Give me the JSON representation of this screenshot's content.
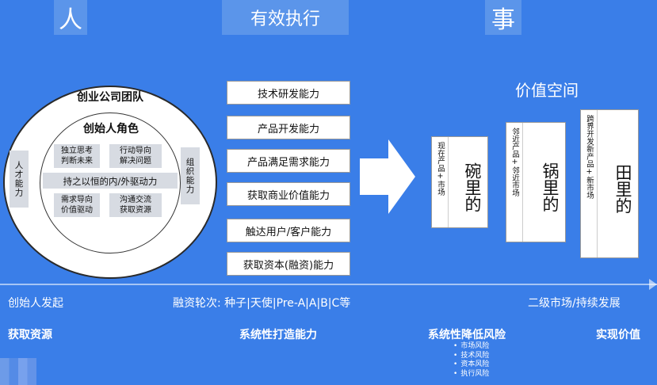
{
  "header": {
    "left": "人",
    "middle": "有效执行",
    "right": "事"
  },
  "team": {
    "title": "创业公司团队",
    "founder_title": "创始人角色",
    "traits": [
      "独立思考\n判断未来",
      "行动导向\n解决问题",
      "持之以恒的内/外驱动力",
      "需求导向\n价值驱动",
      "沟通交流\n获取资源"
    ],
    "side_left": "人才能力",
    "side_right": "组织能力"
  },
  "capabilities": [
    "技术研发能力",
    "产品开发能力",
    "产品满足需求能力",
    "获取商业价值能力",
    "触达用户/客户能力",
    "获取资本(融资)能力"
  ],
  "value": {
    "title": "价值空间",
    "bowls": [
      {
        "small": "现在产品+市场",
        "big": "碗里的"
      },
      {
        "small": "邻近产品+邻近市场",
        "big": "锅里的"
      },
      {
        "small": "跨界开发新产品+新市场",
        "big": "田里的"
      }
    ]
  },
  "timeline": {
    "left": "创始人发起",
    "middle": "融资轮次: 种子|天使|Pre-A|A|B|C等",
    "right": "二级市场/持续发展"
  },
  "bottom": {
    "items": [
      "获取资源",
      "系统性打造能力",
      "系统性降低风险",
      "实现价值"
    ],
    "risks": [
      "市场风险",
      "技术风险",
      "资本风险",
      "执行风险"
    ]
  },
  "colors": {
    "background": "#3a7ee8",
    "header_box": "#5b95ea",
    "trait_box": "#d7dbe2"
  }
}
